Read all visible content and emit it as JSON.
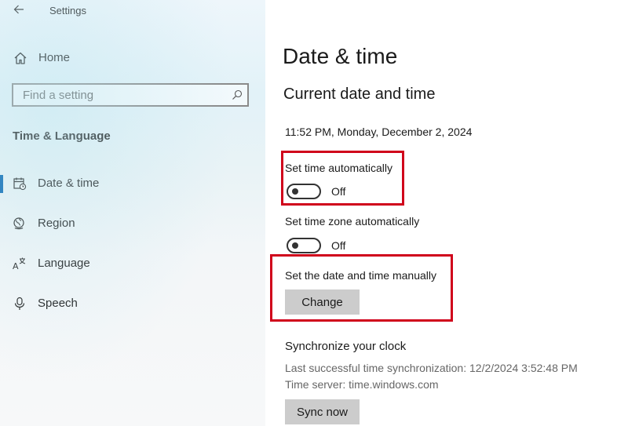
{
  "window": {
    "app_title": "Settings"
  },
  "sidebar": {
    "home_label": "Home",
    "search_placeholder": "Find a setting",
    "section_title": "Time & Language",
    "items": [
      {
        "label": "Date & time",
        "icon": "calendar-clock-icon",
        "selected": true
      },
      {
        "label": "Region",
        "icon": "globe-icon",
        "selected": false
      },
      {
        "label": "Language",
        "icon": "language-icon",
        "selected": false
      },
      {
        "label": "Speech",
        "icon": "microphone-icon",
        "selected": false
      }
    ]
  },
  "main": {
    "page_title": "Date & time",
    "section_title": "Current date and time",
    "current_datetime": "11:52 PM, Monday, December 2, 2024",
    "set_time_auto": {
      "label": "Set time automatically",
      "state": "Off"
    },
    "set_timezone_auto": {
      "label": "Set time zone automatically",
      "state": "Off"
    },
    "manual": {
      "label": "Set the date and time manually",
      "button": "Change"
    },
    "sync": {
      "title": "Synchronize your clock",
      "last_sync": "Last successful time synchronization: 12/2/2024 3:52:48 PM",
      "time_server": "Time server: time.windows.com",
      "button": "Sync now"
    }
  },
  "colors": {
    "accent": "#0063b1",
    "highlight": "#d0021b",
    "button_bg": "#cccccc"
  }
}
